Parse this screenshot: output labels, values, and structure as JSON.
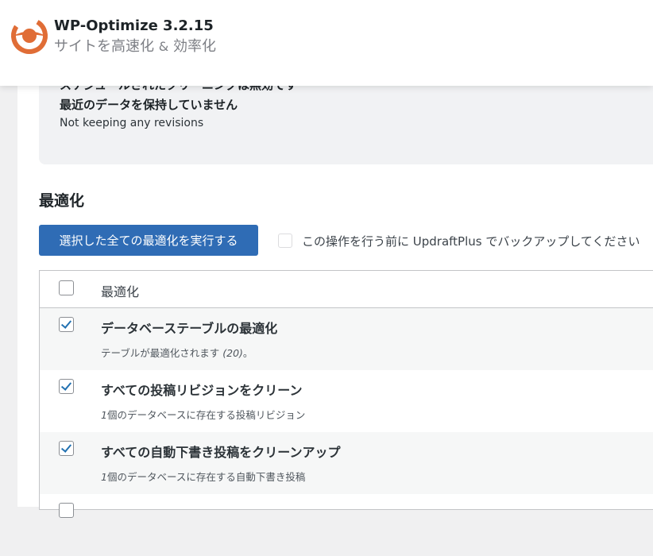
{
  "header": {
    "title": "WP-Optimize 3.2.15",
    "subtitle_main": "サイトを高速化",
    "subtitle_amp": "&",
    "subtitle_end": "効率化",
    "logo_icon": "wp-optimize-logo-icon",
    "brand_color": "#e06d36"
  },
  "status": {
    "line1_cut": "スケジュールされたクリーニングは無効です",
    "line2": "最近のデータを保持していません",
    "sub": "Not keeping any revisions"
  },
  "section": {
    "title": "最適化",
    "run_button": "選択した全ての最適化を実行する",
    "backup_label": "この操作を行う前に UpdraftPlus でバックアップしてください"
  },
  "table": {
    "header": "最適化",
    "rows": [
      {
        "title": "データベーステーブルの最適化",
        "desc_pre": "テーブルが最適化されます ",
        "desc_em": "(20)",
        "desc_post": "。",
        "checked": true
      },
      {
        "title": "すべての投稿リビジョンをクリーン",
        "desc_em": "1",
        "desc_post": "個のデータベースに存在する投稿リビジョン",
        "checked": true
      },
      {
        "title": "すべての自動下書き投稿をクリーンアップ",
        "desc_em": "1",
        "desc_post": "個のデータベースに存在する自動下書き投稿",
        "checked": true
      }
    ]
  },
  "colors": {
    "primary_button": "#2f6cb5",
    "checkmark": "#2271b1"
  }
}
